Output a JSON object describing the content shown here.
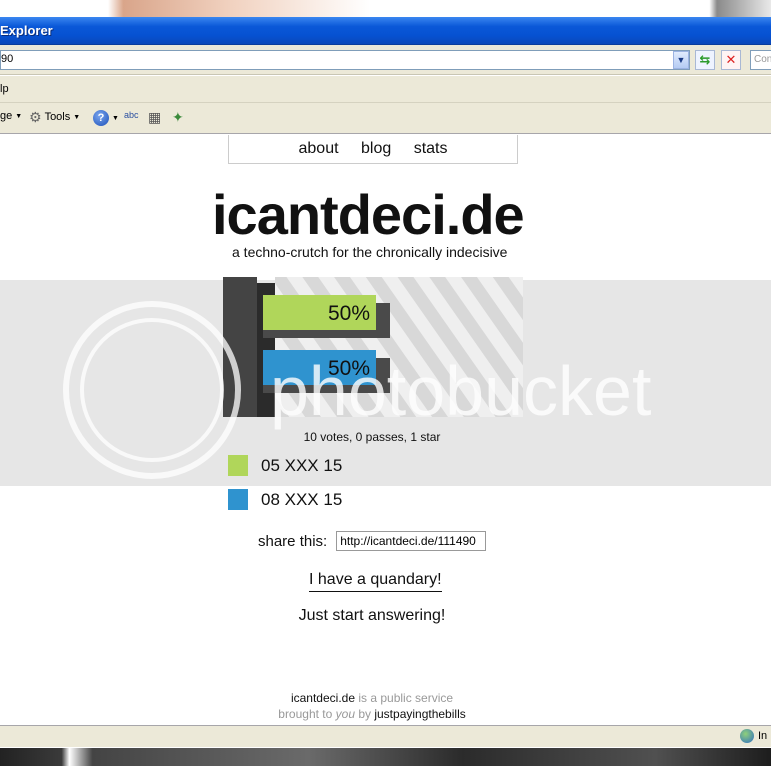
{
  "window": {
    "title": "Explorer",
    "address": "90",
    "search_placeholder": "Con"
  },
  "menubar": {
    "visible_text": "lp"
  },
  "commandbar": {
    "page_label": "ge",
    "tools_label": "Tools",
    "spell_label": "abc"
  },
  "nav": {
    "about": "about",
    "blog": "blog",
    "stats": "stats"
  },
  "site": {
    "brand": "icantdeci.de",
    "tagline": "a techno-crutch for the chronically indecisive"
  },
  "chart_data": {
    "type": "bar",
    "orientation": "horizontal",
    "categories": [
      "05 XXX 15",
      "08 XXX 15"
    ],
    "values": [
      50,
      50
    ],
    "value_labels": [
      "50%",
      "50%"
    ],
    "colors": [
      "#b0d65a",
      "#2f93cf"
    ]
  },
  "poll": {
    "votes_text": "10 votes, 0 passes, 1 star",
    "options": [
      {
        "label": "05 XXX 15",
        "color": "#b0d65a"
      },
      {
        "label": "08 XXX 15",
        "color": "#2f93cf"
      }
    ]
  },
  "share": {
    "label": "share this:",
    "url": "http://icantdeci.de/111490"
  },
  "actions": {
    "quandary": "I have a quandary!",
    "answering": "Just start answering!"
  },
  "footer": {
    "site": "icantdeci.de",
    "public": " is a public service",
    "brought": "brought to ",
    "you": "you",
    "by": " by ",
    "company": "justpayingthebills"
  },
  "watermark": {
    "text": "photobucket"
  },
  "status": {
    "zone": "In"
  }
}
